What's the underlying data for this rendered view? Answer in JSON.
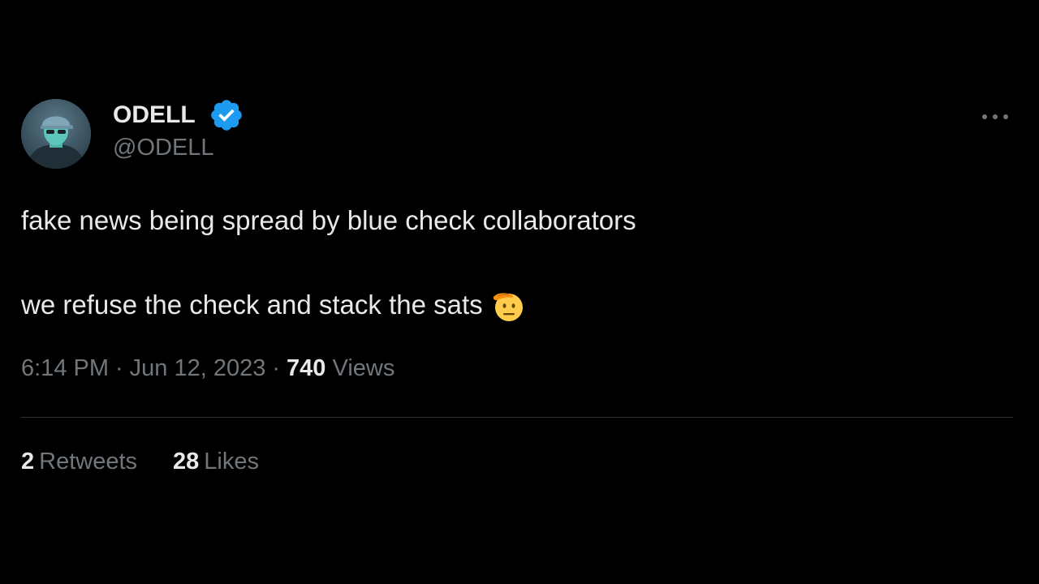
{
  "author": {
    "display_name": "ODELL",
    "handle": "@ODELL",
    "verified": true
  },
  "tweet": {
    "line1": "fake news being spread by blue check collaborators",
    "line2": "we refuse the check and stack the sats",
    "emoji": "saluting-face-icon"
  },
  "meta": {
    "time": "6:14 PM",
    "separator": "·",
    "date": "Jun 12, 2023",
    "views_count": "740",
    "views_label": "Views"
  },
  "stats": {
    "retweets_count": "2",
    "retweets_label": "Retweets",
    "likes_count": "28",
    "likes_label": "Likes"
  },
  "colors": {
    "background": "#000000",
    "primary_text": "#e7e9ea",
    "secondary_text": "#71767b",
    "verified_blue": "#1d9bf0",
    "divider": "#2f3336"
  }
}
